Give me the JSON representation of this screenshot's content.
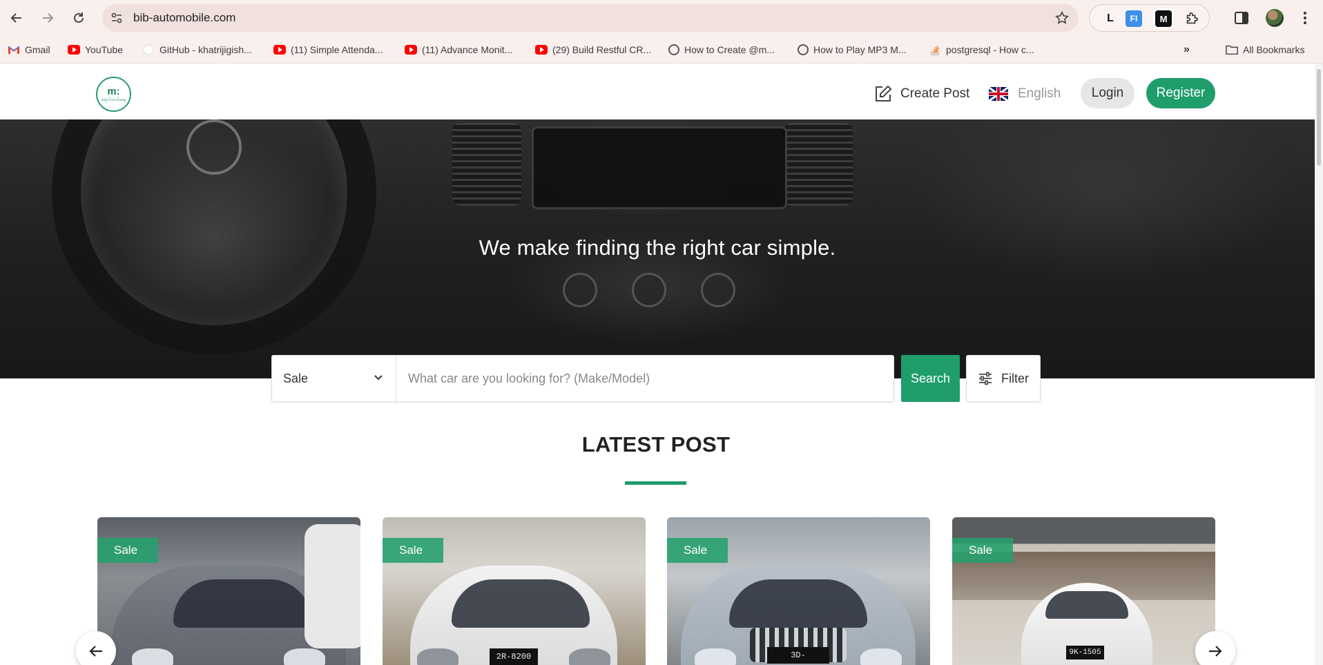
{
  "browser": {
    "url": "bib-automobile.com",
    "extensions": [
      "L",
      "FI",
      "M"
    ],
    "bookmarks": [
      {
        "label": "Gmail",
        "icon": "gmail-icon"
      },
      {
        "label": "YouTube",
        "icon": "youtube-icon"
      },
      {
        "label": "GitHub - khatrijigish...",
        "icon": "github-icon"
      },
      {
        "label": "(11) Simple Attenda...",
        "icon": "youtube-icon"
      },
      {
        "label": "(11) Advance Monit...",
        "icon": "youtube-icon"
      },
      {
        "label": "(29) Build Restful CR...",
        "icon": "youtube-icon"
      },
      {
        "label": "How to Create @m...",
        "icon": "globe-icon"
      },
      {
        "label": "How to Play MP3 M...",
        "icon": "globe-icon"
      },
      {
        "label": "postgresql - How c...",
        "icon": "stackoverflow-icon"
      }
    ],
    "all_bookmarks_label": "All Bookmarks"
  },
  "header": {
    "logo_text": "m:",
    "logo_subtext": "ရောင်းဝယ်ရေး",
    "create_post_label": "Create Post",
    "language_label": "English",
    "login_label": "Login",
    "register_label": "Register"
  },
  "hero": {
    "title": "We make finding the right car simple."
  },
  "search": {
    "type_selected": "Sale",
    "placeholder": "What car are you looking for? (Make/Model)",
    "value": "",
    "search_label": "Search",
    "filter_label": "Filter"
  },
  "latest": {
    "title": "LATEST POST",
    "cards": [
      {
        "badge": "Sale",
        "plate": ""
      },
      {
        "badge": "Sale",
        "plate": "2R-8200"
      },
      {
        "badge": "Sale",
        "plate": "3D-"
      },
      {
        "badge": "Sale",
        "plate": "9K-1505"
      }
    ]
  },
  "colors": {
    "brand_green": "#1f9d6a",
    "chrome_bg": "#f9efec"
  }
}
